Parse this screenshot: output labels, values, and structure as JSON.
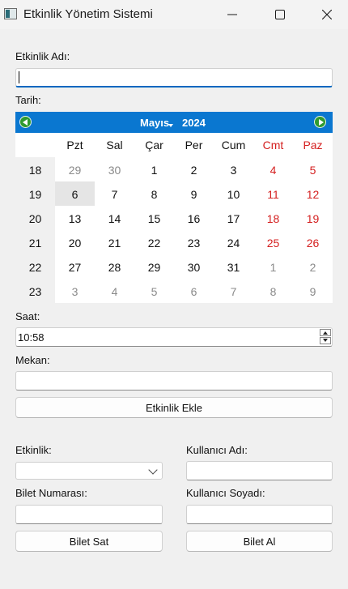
{
  "window": {
    "title": "Etkinlik Yönetim Sistemi"
  },
  "form": {
    "name_label": "Etkinlik Adı:",
    "name_value": "",
    "date_label": "Tarih:",
    "time_label": "Saat:",
    "time_value": "10:58",
    "venue_label": "Mekan:",
    "venue_value": "",
    "add_button": "Etkinlik Ekle"
  },
  "calendar": {
    "month": "Mayıs",
    "year": "2024",
    "days_of_week": [
      "Pzt",
      "Sal",
      "Çar",
      "Per",
      "Cum",
      "Cmt",
      "Paz"
    ],
    "selected_day": "6",
    "weeks": [
      {
        "number": "18",
        "days": [
          "29",
          "30",
          "1",
          "2",
          "3",
          "4",
          "5"
        ]
      },
      {
        "number": "19",
        "days": [
          "6",
          "7",
          "8",
          "9",
          "10",
          "11",
          "12"
        ]
      },
      {
        "number": "20",
        "days": [
          "13",
          "14",
          "15",
          "16",
          "17",
          "18",
          "19"
        ]
      },
      {
        "number": "21",
        "days": [
          "20",
          "21",
          "22",
          "23",
          "24",
          "25",
          "26"
        ]
      },
      {
        "number": "22",
        "days": [
          "27",
          "28",
          "29",
          "30",
          "31",
          "1",
          "2"
        ]
      },
      {
        "number": "23",
        "days": [
          "3",
          "4",
          "5",
          "6",
          "7",
          "8",
          "9"
        ]
      }
    ]
  },
  "ticket": {
    "event_label": "Etkinlik:",
    "event_value": "",
    "ticket_no_label": "Bilet Numarası:",
    "ticket_no_value": "",
    "sell_button": "Bilet Sat",
    "username_label": "Kullanıcı Adı:",
    "username_value": "",
    "surname_label": "Kullanıcı Soyadı:",
    "surname_value": "",
    "buy_button": "Bilet Al"
  },
  "colors": {
    "calendar_header": "#0a77d0",
    "weekend": "#d42020",
    "other_month": "#8a8a8a",
    "accent": "#0067c0"
  }
}
